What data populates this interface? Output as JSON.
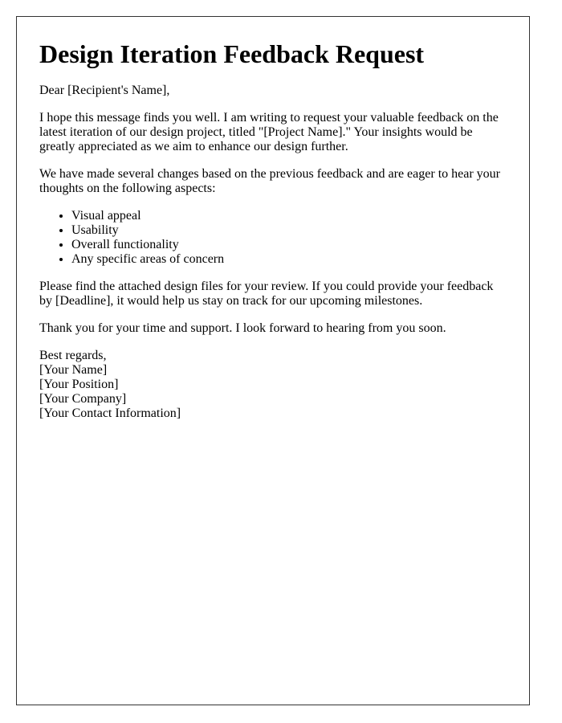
{
  "document": {
    "title": "Design Iteration Feedback Request",
    "greeting": "Dear [Recipient's Name],",
    "paragraphs": [
      "I hope this message finds you well. I am writing to request your valuable feedback on the latest iteration of our design project, titled \"[Project Name].\" Your insights would be greatly appreciated as we aim to enhance our design further.",
      "We have made several changes based on the previous feedback and are eager to hear your thoughts on the following aspects:"
    ],
    "aspects": [
      "Visual appeal",
      "Usability",
      "Overall functionality",
      "Any specific areas of concern"
    ],
    "closing_paragraphs": [
      "Please find the attached design files for your review. If you could provide your feedback by [Deadline], it would help us stay on track for our upcoming milestones.",
      "Thank you for your time and support. I look forward to hearing from you soon."
    ],
    "signature": {
      "closing": "Best regards,",
      "name": "[Your Name]",
      "position": "[Your Position]",
      "company": "[Your Company]",
      "contact": "[Your Contact Information]"
    }
  }
}
